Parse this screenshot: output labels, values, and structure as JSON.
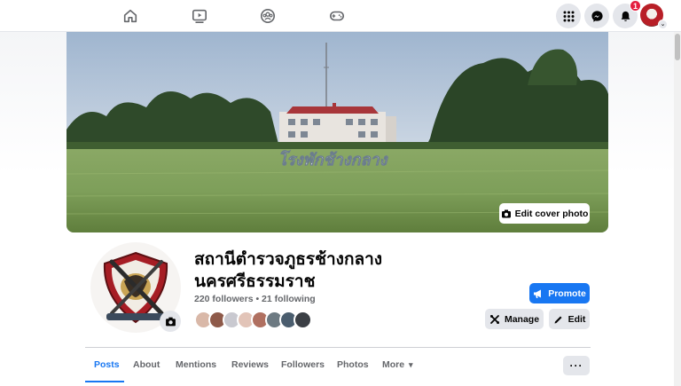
{
  "nav": {
    "notification_count": "1"
  },
  "cover": {
    "edit_label": "Edit cover photo",
    "sign_text": "โรงพักช้างกลาง"
  },
  "profile": {
    "name": "สถานีตำรวจภูธรช้างกลาง นครศรีธรรมราช",
    "stats": "220 followers • 21 following",
    "friend_colors": [
      "#d9b8a8",
      "#8e5a4a",
      "#c9c9d0",
      "#e2c4b8",
      "#b07060",
      "#6d7a82",
      "#4a5d6e",
      "#3b3f45"
    ]
  },
  "actions": {
    "promote_label": "Promote",
    "manage_label": "Manage",
    "edit_label": "Edit"
  },
  "tabs": [
    "Posts",
    "About",
    "Mentions",
    "Reviews",
    "Followers",
    "Photos",
    "More"
  ],
  "tabs_more_caret": "▾",
  "more_options": "···",
  "colors": {
    "accent": "#1877f2",
    "badge": "#e41e3f"
  }
}
